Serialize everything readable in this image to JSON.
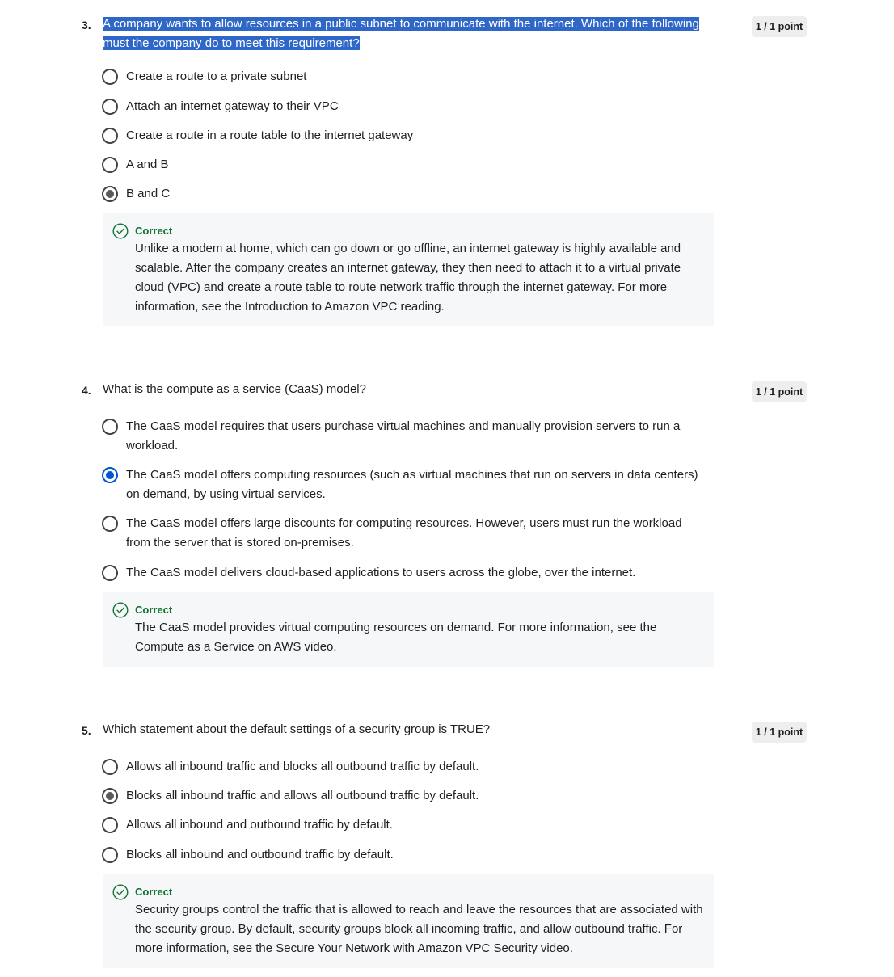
{
  "questions": [
    {
      "number": "3.",
      "prompt": "A company wants to allow resources in a public subnet to communicate with the internet. Which of the following must the company do to meet this requirement?",
      "points": "1 / 1 point",
      "options": [
        {
          "label": "Create a route to a private subnet",
          "selected": false
        },
        {
          "label": "Attach an internet gateway to their VPC",
          "selected": false
        },
        {
          "label": "Create a route in a route table to the internet gateway",
          "selected": false
        },
        {
          "label": "A and B",
          "selected": false
        },
        {
          "label": "B and C",
          "selected": true
        }
      ],
      "feedback": {
        "title": "Correct",
        "text": "Unlike a modem at home, which can go down or go offline, an internet gateway is highly available and scalable. After the company creates an internet gateway, they then need to attach it to a virtual private cloud (VPC) and create a route table to route network traffic through the internet gateway. For more information, see the Introduction to Amazon VPC reading."
      }
    },
    {
      "number": "4.",
      "prompt": "What is the compute as a service (CaaS) model?",
      "points": "1 / 1 point",
      "options": [
        {
          "label": "The CaaS model requires that users purchase virtual machines and manually provision servers to run a workload.",
          "selected": false
        },
        {
          "label": "The CaaS model offers computing resources (such as virtual machines that run on servers in data centers) on demand, by using virtual services.",
          "selected": true
        },
        {
          "label": "The CaaS model offers large discounts for computing resources. However, users must run the workload from the server that is stored on-premises.",
          "selected": false
        },
        {
          "label": "The CaaS model delivers cloud-based applications to users across the globe, over the internet.",
          "selected": false
        }
      ],
      "feedback": {
        "title": "Correct",
        "text": "The CaaS model provides virtual computing resources on demand. For more information, see the Compute as a Service on AWS video."
      }
    },
    {
      "number": "5.",
      "prompt": "Which statement about the default settings of a security group is TRUE?",
      "points": "1 / 1 point",
      "options": [
        {
          "label": "Allows all inbound traffic and blocks all outbound traffic by default.",
          "selected": false
        },
        {
          "label": "Blocks all inbound traffic and allows all outbound traffic by default.",
          "selected": true
        },
        {
          "label": "Allows all inbound and outbound traffic by default.",
          "selected": false
        },
        {
          "label": "Blocks all inbound and outbound traffic by default.",
          "selected": false
        }
      ],
      "feedback": {
        "title": "Correct",
        "text": "Security groups control the traffic that is allowed to reach and leave the resources that are associated with the security group. By default, security groups block all incoming traffic, and allow outbound traffic. For more information, see the Secure Your Network with Amazon VPC Security video."
      }
    }
  ],
  "colors": {
    "selection_highlight": "#2f67c9",
    "correct_green": "#137333",
    "radio_selected_blue": "#0056d2",
    "feedback_background": "#f5f7f8",
    "points_badge_background": "#eeeeee"
  }
}
